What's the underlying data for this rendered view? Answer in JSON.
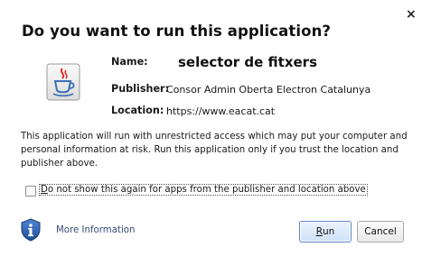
{
  "dialog": {
    "title": "Do you want to run this application?",
    "close_glyph": "×"
  },
  "app": {
    "name_label": "Name:",
    "name_value": "selector de fitxers",
    "publisher_label": "Publisher:",
    "publisher_value": "Consor Admin Oberta Electron Catalunya",
    "location_label": "Location:",
    "location_value": "https://www.eacat.cat",
    "icon": "java-coffee-cup-icon"
  },
  "warning_text": "This application will run with unrestricted access which may put your computer and personal information at risk. Run this application only if you trust the location and publisher above.",
  "checkbox": {
    "checked": false,
    "label_mnemonic": "D",
    "label_rest": "o not show this again for apps from the publisher and location above"
  },
  "footer": {
    "info_icon": "shield-info-icon",
    "more_info_label": "More Information",
    "run_mnemonic": "R",
    "run_rest": "un",
    "cancel_label": "Cancel"
  },
  "colors": {
    "run_border": "#5b86c4",
    "link": "#3a4b7a",
    "shield": "#2a5aa8"
  }
}
